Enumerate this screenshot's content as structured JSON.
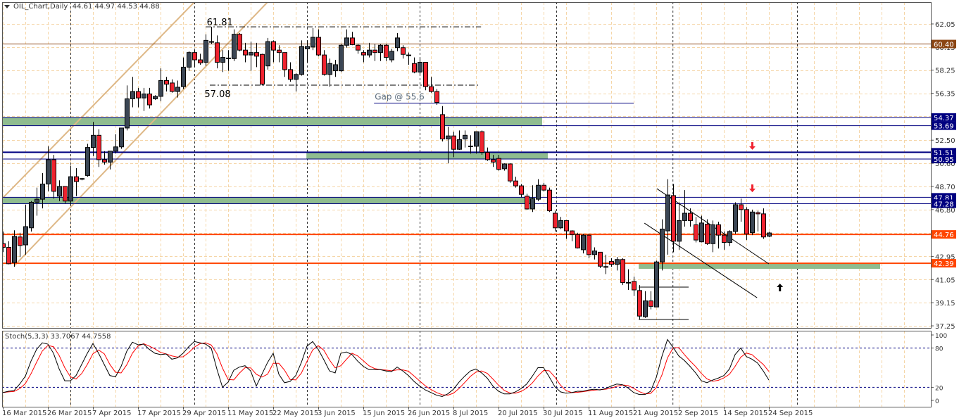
{
  "header": {
    "symbol_label": "OIL_Chart,Daily",
    "ohlc": "44.61 44.97 44.53 44.88"
  },
  "colors": {
    "bull": "#3b4654",
    "bear": "#f0232f",
    "grid": "#f5d6a8",
    "month_sep": "#333333",
    "channel": "#deb887",
    "zone": "#8fbc8f",
    "navy": "#000080",
    "brown": "#8b4513",
    "orange": "#ff4500"
  },
  "chart_data": {
    "type": "candlestick",
    "ohlc": [
      [
        44.0,
        45.0,
        43.3,
        43.7
      ],
      [
        43.7,
        44.2,
        42.3,
        42.35
      ],
      [
        42.45,
        45.1,
        42.1,
        44.6
      ],
      [
        44.55,
        44.9,
        42.9,
        43.85
      ],
      [
        43.9,
        47.2,
        43.1,
        45.4
      ],
      [
        45.3,
        47.5,
        45.0,
        47.4
      ],
      [
        47.4,
        48.6,
        46.3,
        47.65
      ],
      [
        47.65,
        49.8,
        46.9,
        48.9
      ],
      [
        48.9,
        52.0,
        48.3,
        50.9
      ],
      [
        50.9,
        51.3,
        47.7,
        48.3
      ],
      [
        47.9,
        49.2,
        47.5,
        48.7
      ],
      [
        48.7,
        48.7,
        47.3,
        47.5
      ],
      [
        47.5,
        50.4,
        47.1,
        49.5
      ],
      [
        49.5,
        50.2,
        47.9,
        49.1
      ],
      [
        49.3,
        49.4,
        49.2,
        49.35
      ],
      [
        49.6,
        52.2,
        49.5,
        51.9
      ],
      [
        51.9,
        54.0,
        51.2,
        52.9
      ],
      [
        52.9,
        53.4,
        50.3,
        50.9
      ],
      [
        50.9,
        51.6,
        50.5,
        50.7
      ],
      [
        50.7,
        51.6,
        50.1,
        51.6
      ],
      [
        51.6,
        53.0,
        51.4,
        51.95
      ],
      [
        51.95,
        53.5,
        51.8,
        53.5
      ],
      [
        53.5,
        57.0,
        53.3,
        55.9
      ],
      [
        55.9,
        57.7,
        55.2,
        56.5
      ],
      [
        56.5,
        56.8,
        55.2,
        55.97
      ],
      [
        55.97,
        56.8,
        54.9,
        56.3
      ],
      [
        56.3,
        56.8,
        55.1,
        55.4
      ],
      [
        55.9,
        56.2,
        55.8,
        56.1
      ],
      [
        56.1,
        58.4,
        55.7,
        57.4
      ],
      [
        57.4,
        57.7,
        56.5,
        57.1
      ],
      [
        57.2,
        57.5,
        56.4,
        56.5
      ],
      [
        56.5,
        57.4,
        56.0,
        56.85
      ],
      [
        56.9,
        59.3,
        56.7,
        58.5
      ],
      [
        58.5,
        59.8,
        58.2,
        59.7
      ],
      [
        59.7,
        59.9,
        58.5,
        59.1
      ],
      [
        59.1,
        59.6,
        58.7,
        58.85
      ],
      [
        58.9,
        61.2,
        58.6,
        60.7
      ],
      [
        60.55,
        61.81,
        60.4,
        60.6
      ],
      [
        60.5,
        61.1,
        58.4,
        58.9
      ],
      [
        58.9,
        59.9,
        58.1,
        59.3
      ],
      [
        59.2,
        59.9,
        58.2,
        59.25
      ],
      [
        59.2,
        61.6,
        59.0,
        61.2
      ],
      [
        61.2,
        61.3,
        59.8,
        59.9
      ],
      [
        59.9,
        60.5,
        58.9,
        59.5
      ],
      [
        59.5,
        60.6,
        58.2,
        59.7
      ],
      [
        59.7,
        60.5,
        58.5,
        59.4
      ],
      [
        59.55,
        59.6,
        57.0,
        57.1
      ],
      [
        58.6,
        60.9,
        58.3,
        60.6
      ],
      [
        60.6,
        60.7,
        58.9,
        59.9
      ],
      [
        59.9,
        60.3,
        58.9,
        59.7
      ],
      [
        59.7,
        59.7,
        57.7,
        58.3
      ],
      [
        58.3,
        58.9,
        57.3,
        57.5
      ],
      [
        57.5,
        58.0,
        56.5,
        57.9
      ],
      [
        57.9,
        60.7,
        57.8,
        60.2
      ],
      [
        60.0,
        60.7,
        58.9,
        60.2
      ],
      [
        60.15,
        61.7,
        59.9,
        60.95
      ],
      [
        60.95,
        61.6,
        59.4,
        59.5
      ],
      [
        59.5,
        59.9,
        57.8,
        57.9
      ],
      [
        57.9,
        59.2,
        56.9,
        58.8
      ],
      [
        58.2,
        59.1,
        57.7,
        58.7
      ],
      [
        58.2,
        60.4,
        58.1,
        60.3
      ],
      [
        60.3,
        61.6,
        60.1,
        60.9
      ],
      [
        60.9,
        61.4,
        60.3,
        60.35
      ],
      [
        60.3,
        60.4,
        59.6,
        59.9
      ],
      [
        59.7,
        59.9,
        58.9,
        59.5
      ],
      [
        59.5,
        60.5,
        59.3,
        59.9
      ],
      [
        59.9,
        60.4,
        59.0,
        59.7
      ],
      [
        59.7,
        60.4,
        59.0,
        60.3
      ],
      [
        60.3,
        60.4,
        59.0,
        59.3
      ],
      [
        59.1,
        60.0,
        58.9,
        59.8
      ],
      [
        60.1,
        61.3,
        59.8,
        60.9
      ],
      [
        60.1,
        60.3,
        59.2,
        59.55
      ],
      [
        59.45,
        59.7,
        58.7,
        59.5
      ],
      [
        58.8,
        59.3,
        58.0,
        58.1
      ],
      [
        58.1,
        59.3,
        57.9,
        58.9
      ],
      [
        58.9,
        58.9,
        56.6,
        56.9
      ],
      [
        56.9,
        57.7,
        56.4,
        56.5
      ],
      [
        56.5,
        56.7,
        55.4,
        55.6
      ],
      [
        54.6,
        55.3,
        52.4,
        52.6
      ],
      [
        52.6,
        53.6,
        50.6,
        52.85
      ],
      [
        52.85,
        53.2,
        51.1,
        51.75
      ],
      [
        51.75,
        53.3,
        51.7,
        52.55
      ],
      [
        52.6,
        53.3,
        51.9,
        52.9
      ],
      [
        52.0,
        52.9,
        51.4,
        52.02
      ],
      [
        52.0,
        53.2,
        51.4,
        53.2
      ],
      [
        53.2,
        53.3,
        51.3,
        51.5
      ],
      [
        51.5,
        51.9,
        50.8,
        50.9
      ],
      [
        50.9,
        51.3,
        50.3,
        50.7
      ],
      [
        51.0,
        51.3,
        50.0,
        50.1
      ],
      [
        50.15,
        50.6,
        50.0,
        50.55
      ],
      [
        50.55,
        50.6,
        49.0,
        49.15
      ],
      [
        49.15,
        49.5,
        48.6,
        48.75
      ],
      [
        48.75,
        48.9,
        47.8,
        48.05
      ],
      [
        47.9,
        48.1,
        46.8,
        46.85
      ],
      [
        46.85,
        48.8,
        46.6,
        47.7
      ],
      [
        47.65,
        49.3,
        47.5,
        48.8
      ],
      [
        48.8,
        49.0,
        48.3,
        48.4
      ],
      [
        48.4,
        48.6,
        46.6,
        46.7
      ],
      [
        46.5,
        46.7,
        45.0,
        45.3
      ],
      [
        45.3,
        46.2,
        45.2,
        45.9
      ],
      [
        45.9,
        45.9,
        44.4,
        45.05
      ],
      [
        45.05,
        45.1,
        44.2,
        44.75
      ],
      [
        44.75,
        44.9,
        43.6,
        43.65
      ],
      [
        43.5,
        44.8,
        43.2,
        44.7
      ],
      [
        44.7,
        44.8,
        42.8,
        43.1
      ],
      [
        43.1,
        43.7,
        42.7,
        43.4
      ],
      [
        43.3,
        43.3,
        42.0,
        42.15
      ],
      [
        42.1,
        43.1,
        41.5,
        42.12
      ],
      [
        42.55,
        42.8,
        42.1,
        42.3
      ],
      [
        42.3,
        42.9,
        41.8,
        42.7
      ],
      [
        42.7,
        42.8,
        40.6,
        40.8
      ],
      [
        40.8,
        41.9,
        40.2,
        40.82
      ],
      [
        40.9,
        41.3,
        39.7,
        40.2
      ],
      [
        40.15,
        40.6,
        37.75,
        38.05
      ],
      [
        38.0,
        40.1,
        37.9,
        39.3
      ],
      [
        39.3,
        40.1,
        38.6,
        38.85
      ],
      [
        38.8,
        42.6,
        38.8,
        42.5
      ],
      [
        42.5,
        46.0,
        41.8,
        45.2
      ],
      [
        45.05,
        49.3,
        43.1,
        48.0
      ],
      [
        47.95,
        48.9,
        43.3,
        44.2
      ],
      [
        44.2,
        47.4,
        43.5,
        45.9
      ],
      [
        45.9,
        48.4,
        45.4,
        46.5
      ],
      [
        46.5,
        46.9,
        45.4,
        45.9
      ],
      [
        45.55,
        46.2,
        44.1,
        44.3
      ],
      [
        44.15,
        46.3,
        44.1,
        45.7
      ],
      [
        45.6,
        46.0,
        43.9,
        44.0
      ],
      [
        44.0,
        45.9,
        43.3,
        45.55
      ],
      [
        45.55,
        45.8,
        43.6,
        44.7
      ],
      [
        44.7,
        45.0,
        43.5,
        44.1
      ],
      [
        44.1,
        45.1,
        43.8,
        45.0
      ],
      [
        45.0,
        47.4,
        44.8,
        47.2
      ],
      [
        47.2,
        47.7,
        45.8,
        46.8
      ],
      [
        46.8,
        47.0,
        44.3,
        44.8
      ],
      [
        44.9,
        46.8,
        44.7,
        46.6
      ],
      [
        46.55,
        46.7,
        45.0,
        46.45
      ],
      [
        46.45,
        46.9,
        44.4,
        44.55
      ],
      [
        44.61,
        44.97,
        44.53,
        44.88
      ]
    ],
    "price_axis": {
      "range": [
        37.25,
        62.05
      ],
      "ticks": [
        "62.05",
        "60.15",
        "58.25",
        "56.35",
        "54.45",
        "52.50",
        "50.60",
        "48.70",
        "46.80",
        "44.90",
        "42.95",
        "41.05",
        "39.15",
        "37.25"
      ]
    },
    "date_labels": [
      {
        "bar": 0,
        "label": "16 Mar 2015"
      },
      {
        "bar": 8,
        "label": "26 Mar 2015"
      },
      {
        "bar": 16,
        "label": "7 Apr 2015"
      },
      {
        "bar": 24,
        "label": "17 Apr 2015"
      },
      {
        "bar": 32,
        "label": "29 Apr 2015"
      },
      {
        "bar": 40,
        "label": "11 May 2015"
      },
      {
        "bar": 48,
        "label": "22 May 2015"
      },
      {
        "bar": 56,
        "label": "3 Jun 2015"
      },
      {
        "bar": 64,
        "label": "15 Jun 2015"
      },
      {
        "bar": 72,
        "label": "26 Jun 2015"
      },
      {
        "bar": 80,
        "label": "8 Jul 2015"
      },
      {
        "bar": 88,
        "label": "20 Jul 2015"
      },
      {
        "bar": 96,
        "label": "30 Jul 2015"
      },
      {
        "bar": 104,
        "label": "11 Aug 2015"
      },
      {
        "bar": 112,
        "label": "21 Aug 2015"
      },
      {
        "bar": 120,
        "label": "2 Sep 2015"
      },
      {
        "bar": 128,
        "label": "14 Sep 2015"
      },
      {
        "bar": 136,
        "label": "24 Sep 2015"
      }
    ],
    "month_separators": [
      12,
      34,
      54,
      74,
      98.25,
      118.9,
      141
    ],
    "levels": [
      {
        "price": 60.4,
        "label": "60.40",
        "color": "#8b4513",
        "weight": 1
      },
      {
        "price": 54.37,
        "label": "54.37",
        "color": "#000080",
        "weight": 1
      },
      {
        "price": 53.69,
        "label": "53.69",
        "color": "#000080",
        "weight": 1
      },
      {
        "price": 51.51,
        "label": "51.51",
        "color": "#000080",
        "weight": 2
      },
      {
        "price": 50.95,
        "label": "50.95",
        "color": "#000080",
        "weight": 1
      },
      {
        "price": 47.81,
        "label": "47.81",
        "color": "#000080",
        "weight": 1
      },
      {
        "price": 47.28,
        "label": "47.28",
        "color": "#000080",
        "weight": 1
      },
      {
        "price": 44.76,
        "label": "44.76",
        "color": "#ff4500",
        "weight": 2
      },
      {
        "price": 42.39,
        "label": "42.39",
        "color": "#ff4500",
        "weight": 2
      }
    ],
    "zones": [
      {
        "from_bar": -0.2,
        "to_bar": 95.75,
        "low": 53.69,
        "high": 54.37
      },
      {
        "from_bar": 53.9,
        "to_bar": 96.75,
        "low": 50.95,
        "high": 51.51
      },
      {
        "from_bar": -0.2,
        "to_bar": 94.5,
        "low": 47.28,
        "high": 47.81
      },
      {
        "from_bar": 112.9,
        "to_bar": 155.75,
        "low": 41.93,
        "high": 42.39
      }
    ],
    "channel": [
      {
        "from": [
          -0.2,
          47.66
        ],
        "to": [
          34,
          63.84
        ]
      },
      {
        "from": [
          2,
          42.17
        ],
        "to": [
          47,
          63.84
        ]
      }
    ],
    "trendlines": [
      {
        "from": [
          116.1,
          48.52
        ],
        "to": [
          136,
          42.34
        ]
      },
      {
        "from": [
          113.9,
          45.69
        ],
        "to": [
          133.9,
          39.56
        ]
      },
      {
        "from": [
          112.9,
          40.43
        ],
        "to": [
          121.75,
          40.43
        ]
      },
      {
        "from": [
          112.9,
          37.77
        ],
        "to": [
          121.75,
          37.77
        ]
      }
    ],
    "fib_lines": [
      {
        "price": 61.81,
        "from_bar": 36,
        "to_bar": 84.9,
        "text": "61.81",
        "text_bar": 36.2,
        "text_above": true
      },
      {
        "price": 57.02,
        "from_bar": 36.75,
        "to_bar": 84.5,
        "text": "57.08",
        "text_bar": 35.8,
        "text_above": false
      }
    ],
    "gap": {
      "price": 55.55,
      "from_bar": 65.9,
      "to_bar": 112,
      "text": "Gap @ 55.6"
    },
    "arrows": [
      {
        "bar": 133,
        "price": 52.0,
        "dir": "down",
        "color": "#f0232f"
      },
      {
        "bar": 133,
        "price": 48.52,
        "dir": "down",
        "color": "#f0232f"
      },
      {
        "bar": 137.9,
        "price": 40.43,
        "dir": "up",
        "color": "#000000"
      }
    ],
    "stochastic": {
      "label": "Stoch(5,3,3) 33.7067 44.7558",
      "axis_labels": [
        "100",
        "80",
        "20",
        "0"
      ],
      "levels": [
        80,
        20
      ],
      "d_period": 3,
      "k": [
        12,
        14,
        15,
        25,
        37,
        60,
        78,
        88,
        86,
        72,
        48,
        30,
        30,
        38,
        55,
        72,
        87,
        72,
        55,
        38,
        36,
        52,
        75,
        89,
        85,
        86,
        78,
        72,
        70,
        71,
        63,
        65,
        72,
        82,
        90,
        88,
        86,
        80,
        48,
        20,
        28,
        46,
        51,
        53,
        45,
        22,
        40,
        58,
        72,
        40,
        27,
        29,
        38,
        58,
        83,
        90,
        78,
        62,
        45,
        42,
        72,
        74,
        70,
        60,
        52,
        47,
        47,
        47,
        45,
        44,
        51,
        45,
        38,
        29,
        22,
        16,
        12,
        8,
        6,
        10,
        17,
        28,
        37,
        45,
        48,
        42,
        34,
        22,
        14,
        10,
        10,
        13,
        18,
        25,
        37,
        50,
        50,
        36,
        21,
        13,
        11,
        12,
        14,
        14,
        16,
        17,
        16,
        18,
        22,
        25,
        24,
        19,
        12,
        9,
        9,
        14,
        35,
        67,
        93,
        81,
        68,
        61,
        52,
        42,
        30,
        27,
        31,
        34,
        38,
        48,
        70,
        80,
        67,
        63,
        57,
        45,
        31
      ]
    }
  }
}
